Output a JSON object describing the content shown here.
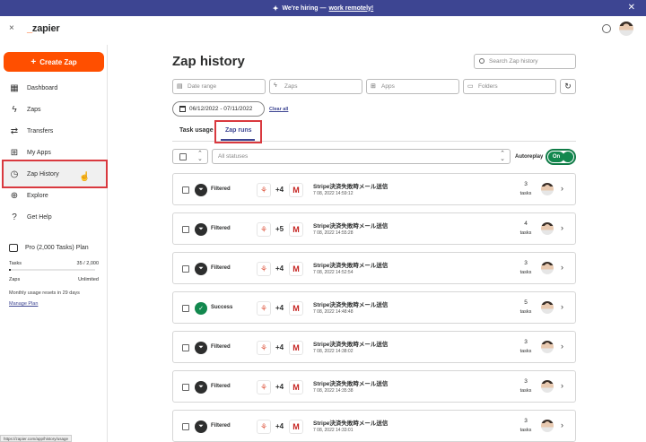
{
  "banner": {
    "text": "We're hiring —",
    "link": "work remotely!",
    "spark_icon": "sparkle-icon",
    "close_icon": "close-icon"
  },
  "topbar": {
    "close_glyph": "×",
    "logo_dash": "_",
    "logo_word": "zapier"
  },
  "sidebar": {
    "create_label": "Create Zap",
    "items": [
      {
        "label": "Dashboard",
        "icon": "dashboard-icon",
        "glyph": "▦"
      },
      {
        "label": "Zaps",
        "icon": "bolt-icon",
        "glyph": "ϟ"
      },
      {
        "label": "Transfers",
        "icon": "transfer-icon",
        "glyph": "⇄"
      },
      {
        "label": "My Apps",
        "icon": "apps-icon",
        "glyph": "⊞"
      },
      {
        "label": "Zap History",
        "icon": "history-icon",
        "glyph": "◷"
      },
      {
        "label": "Explore",
        "icon": "globe-icon",
        "glyph": "⊕"
      },
      {
        "label": "Get Help",
        "icon": "help-icon",
        "glyph": "?"
      }
    ],
    "plan": {
      "title": "Pro (2,000 Tasks) Plan",
      "tasks_label": "Tasks",
      "tasks_value": "35 / 2,000",
      "tasks_used_fraction": 0.0175,
      "zaps_label": "Zaps",
      "zaps_value": "Unlimited",
      "reset_note": "Monthly usage resets in 29 days",
      "manage_label": "Manage Plan"
    }
  },
  "main": {
    "title": "Zap history",
    "search_placeholder": "Search Zap history",
    "filters": {
      "date_range": "Date range",
      "zaps": "Zaps",
      "apps": "Apps",
      "folders": "Folders"
    },
    "date_value": "06/12/2022 - 07/11/2022",
    "clear_all": "Clear all",
    "tabs": {
      "task_usage": "Task usage",
      "zap_runs": "Zap runs"
    },
    "statuses_placeholder": "All statuses",
    "autoreplay_label": "Autoreplay",
    "autoreplay_state": "On"
  },
  "runs": [
    {
      "status": "Filtered",
      "more": "+4",
      "name": "Stripe決済失敗時メール送信",
      "time": "7 08, 2022 14:59:12",
      "tasks": "3",
      "unit": "tasks"
    },
    {
      "status": "Filtered",
      "more": "+5",
      "name": "Stripe決済失敗時メール送信",
      "time": "7 08, 2022 14:55:28",
      "tasks": "4",
      "unit": "tasks"
    },
    {
      "status": "Filtered",
      "more": "+4",
      "name": "Stripe決済失敗時メール送信",
      "time": "7 08, 2022 14:52:54",
      "tasks": "3",
      "unit": "tasks"
    },
    {
      "status": "Success",
      "more": "+4",
      "name": "Stripe決済失敗時メール送信",
      "time": "7 08, 2022 14:48:48",
      "tasks": "5",
      "unit": "tasks"
    },
    {
      "status": "Filtered",
      "more": "+4",
      "name": "Stripe決済失敗時メール送信",
      "time": "7 08, 2022 14:38:02",
      "tasks": "3",
      "unit": "tasks"
    },
    {
      "status": "Filtered",
      "more": "+4",
      "name": "Stripe決済失敗時メール送信",
      "time": "7 08, 2022 14:35:38",
      "tasks": "3",
      "unit": "tasks"
    },
    {
      "status": "Filtered",
      "more": "+4",
      "name": "Stripe決済失敗時メール送信",
      "time": "7 08, 2022 14:33:01",
      "tasks": "3",
      "unit": "tasks"
    }
  ],
  "status_url": "https://zapier.com/app/history/usage"
}
